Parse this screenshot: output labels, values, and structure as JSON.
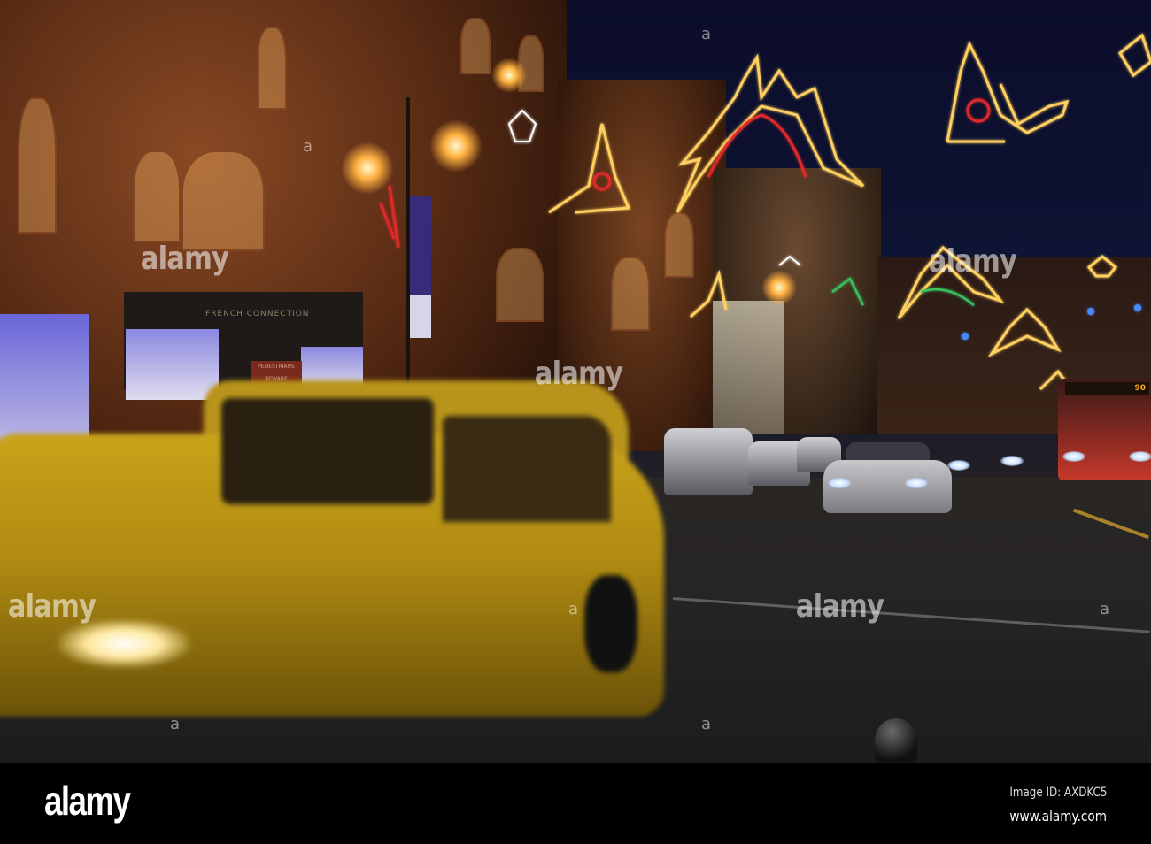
{
  "photo": {
    "shop_sign": "FRENCH CONNECTION",
    "warning_sign": "PEDESTRIANS BEWARE",
    "bus_route_number": "90",
    "watermark": "alamy"
  },
  "footer": {
    "brand": "alamy",
    "image_id": "Image ID: AXDKC5",
    "url": "www.alamy.com"
  },
  "colors": {
    "sky": "#0b0d2a",
    "van_yellow": "#c8a41a",
    "light_gold": "#ffd060",
    "light_red": "#e02a2a",
    "light_green": "#3ac060"
  }
}
